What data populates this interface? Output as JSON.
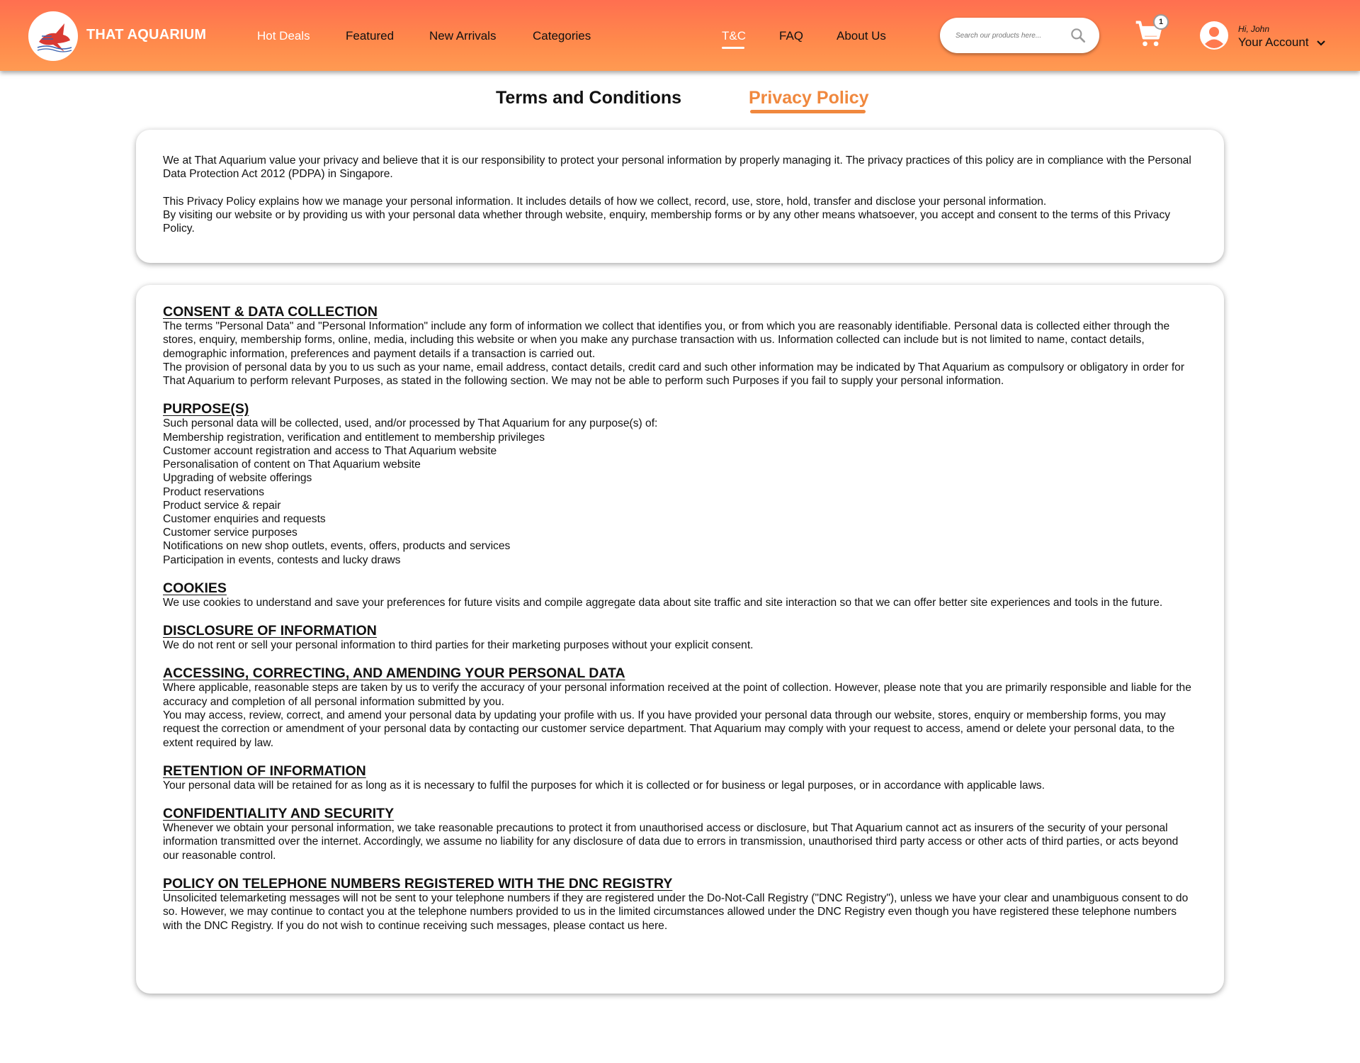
{
  "header": {
    "brand": "THAT AQUARIUM",
    "nav_left": [
      "Hot Deals",
      "Featured",
      "New Arrivals",
      "Categories"
    ],
    "nav_right": [
      "T&C",
      "FAQ",
      "About Us"
    ],
    "active_nav": "T&C",
    "search_placeholder": "Search our products here...",
    "cart_count": "1",
    "greeting": "Hi, John",
    "account_label": "Your Account"
  },
  "tabs": {
    "terms": "Terms and Conditions",
    "privacy": "Privacy Policy",
    "active": "Privacy Policy"
  },
  "intro": {
    "p1": "We at That Aquarium value your privacy and believe that it is our responsibility to protect your personal information by properly managing it. The privacy practices of this policy are in compliance with the Personal Data Protection Act 2012 (PDPA) in Singapore.",
    "p2": "This Privacy Policy explains how we manage your personal information. It includes details of how we collect, record, use, store, hold, transfer and disclose your personal information.",
    "p3": "By visiting our website or by providing us with your personal data whether through website, enquiry, membership forms or by any other means whatsoever, you accept and consent to the terms of this Privacy Policy."
  },
  "sections": {
    "consent": {
      "title": "CONSENT & DATA COLLECTION",
      "p1": "The terms \"Personal Data\" and \"Personal Information\" include any form of information we collect that identifies you, or from which you are reasonably identifiable. Personal data is collected either through the stores, enquiry, membership forms, online, media, including this website or when you make any purchase transaction with us. Information collected can include but is not limited to name, contact details, demographic information, preferences and payment details if a transaction is carried out.",
      "p2": "The provision of personal data by you to us such as your name, email address, contact details, credit card and such other information may be indicated by That Aquarium as compulsory or obligatory in order for That Aquarium to perform relevant Purposes, as stated in the following section. We may not be able to perform such Purposes if you fail to supply your personal information."
    },
    "purposes": {
      "title": "PURPOSE(S)",
      "intro": "Such personal data will be collected, used, and/or processed by That Aquarium for any purpose(s) of:",
      "items": [
        "Membership registration, verification and entitlement to membership privileges",
        "Customer account registration and access to That Aquarium website",
        "Personalisation of content on That Aquarium website",
        "Upgrading of website offerings",
        "Product reservations",
        "Product service & repair",
        "Customer enquiries and requests",
        "Customer service purposes",
        "Notifications on new shop outlets, events, offers, products and services",
        "Participation in events, contests and lucky draws"
      ]
    },
    "cookies": {
      "title": "COOKIES",
      "p1": "We use cookies to understand and save your preferences for future visits and compile aggregate data about site traffic and site interaction so that we can offer better site experiences and tools in the future."
    },
    "disclosure": {
      "title": "DISCLOSURE OF INFORMATION",
      "p1": "We do not rent or sell your personal information to third parties for their marketing purposes without your explicit consent."
    },
    "accessing": {
      "title": "ACCESSING, CORRECTING, AND AMENDING YOUR PERSONAL DATA",
      "p1": "Where applicable, reasonable steps are taken by us to verify the accuracy of your personal information received at the point of collection. However, please note that you are primarily responsible and liable for the accuracy and completion of all personal information submitted by you.",
      "p2": "You may access, review, correct, and amend your personal data by updating your profile with us. If you have provided your personal data through our website, stores, enquiry or membership forms, you may request the correction or amendment of your personal data by contacting our customer service department. That Aquarium may comply with your request to access, amend or delete your personal data, to the extent required by law."
    },
    "retention": {
      "title": "RETENTION OF INFORMATION",
      "p1": "Your personal data will be retained for as long as it is necessary to fulfil the purposes for which it is collected or for business or legal purposes, or in accordance with applicable laws."
    },
    "confidentiality": {
      "title": "CONFIDENTIALITY AND SECURITY",
      "p1": "Whenever we obtain your personal information, we take reasonable precautions to protect it from unauthorised access or disclosure, but That Aquarium cannot act as insurers of the security of your personal information transmitted over the internet. Accordingly, we assume no liability for any disclosure of data due to errors in transmission, unauthorised third party access or other acts of third parties, or acts beyond our reasonable control."
    },
    "dnc": {
      "title": "POLICY ON TELEPHONE NUMBERS REGISTERED WITH THE DNC REGISTRY",
      "p1": "Unsolicited telemarketing messages will not be sent to your telephone numbers if they are registered under the Do-Not-Call Registry (\"DNC Registry\"), unless we have your clear and unambiguous consent to do so. However, we may continue to contact you at the telephone numbers provided to us in the limited circumstances allowed under the DNC Registry even though you have registered these telephone numbers with the DNC Registry. If you do not wish to continue receiving such messages, please contact us here."
    }
  },
  "colors": {
    "header_gradient_start": "#ff6f50",
    "header_gradient_end": "#ff9a52",
    "accent": "#f0883e"
  }
}
